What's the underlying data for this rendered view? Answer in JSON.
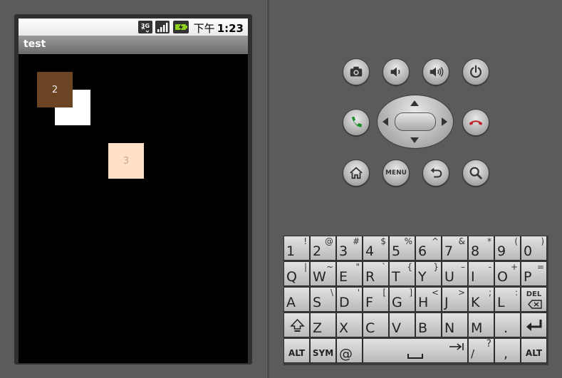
{
  "status_bar": {
    "ampm": "下午",
    "time": "1:23",
    "network": "3G"
  },
  "app": {
    "title": "test"
  },
  "boxes": [
    {
      "label": "2",
      "color": "#6b4424"
    },
    {
      "label": "",
      "color": "#ffffff"
    },
    {
      "label": "3",
      "color": "#ffe0c8"
    }
  ],
  "controls": {
    "row1": [
      "camera-icon",
      "volume-down-icon",
      "volume-up-icon",
      "power-icon"
    ],
    "row2": [
      "call-icon",
      "dpad",
      "end-call-icon"
    ],
    "row3": [
      "home-icon",
      "menu",
      "back-icon",
      "search-icon"
    ],
    "menu_label": "MENU"
  },
  "keyboard": {
    "rows": [
      [
        [
          "1",
          "!"
        ],
        [
          "2",
          "@"
        ],
        [
          "3",
          "#"
        ],
        [
          "4",
          "$"
        ],
        [
          "5",
          "%"
        ],
        [
          "6",
          "^"
        ],
        [
          "7",
          "&"
        ],
        [
          "8",
          "*"
        ],
        [
          "9",
          "("
        ],
        [
          "0",
          ")"
        ]
      ],
      [
        [
          "Q",
          "|"
        ],
        [
          "W",
          "~"
        ],
        [
          "E",
          "\""
        ],
        [
          "R",
          "`"
        ],
        [
          "T",
          "{"
        ],
        [
          "Y",
          "}"
        ],
        [
          "U",
          "–"
        ],
        [
          "I",
          "-"
        ],
        [
          "O",
          "+"
        ],
        [
          "P",
          "="
        ]
      ],
      [
        [
          "A",
          ""
        ],
        [
          "S",
          "\\"
        ],
        [
          "D",
          "'"
        ],
        [
          "F",
          "["
        ],
        [
          "G",
          "]"
        ],
        [
          "H",
          "<"
        ],
        [
          "J",
          ">"
        ],
        [
          "K",
          ";"
        ],
        [
          "L",
          ":"
        ]
      ],
      [
        [
          "Z",
          ""
        ],
        [
          "X",
          ""
        ],
        [
          "C",
          ""
        ],
        [
          "V",
          ""
        ],
        [
          "B",
          ""
        ],
        [
          "N",
          ""
        ],
        [
          "M",
          ""
        ],
        [
          ".",
          ""
        ]
      ],
      [
        [
          "@",
          ""
        ],
        [
          "?",
          "/"
        ],
        [
          ",",
          ""
        ]
      ]
    ],
    "alt_label": "ALT",
    "sym_label": "SYM",
    "del_label": "DEL"
  }
}
